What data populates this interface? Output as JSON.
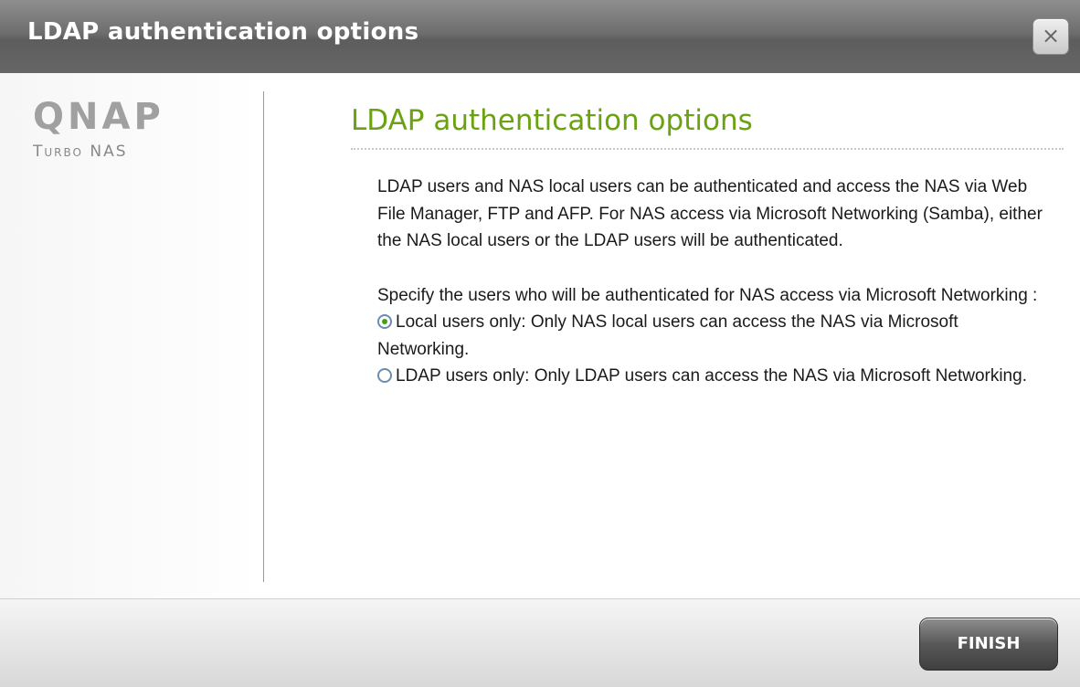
{
  "window": {
    "title": "LDAP authentication options",
    "close_icon": "close-icon",
    "close_glyph": "×"
  },
  "sidebar": {
    "logo_brand": "QNAP",
    "logo_sub": "Turbo NAS"
  },
  "main": {
    "heading": "LDAP authentication options",
    "intro": "LDAP users and NAS local users can be authenticated and access the NAS via Web File Manager, FTP and AFP. For NAS access via Microsoft Networking (Samba), either the NAS local users or the LDAP users will be authenticated.",
    "specify": "Specify the users who will be authenticated for NAS access via Microsoft Networking :",
    "options": [
      {
        "label": "Local users only: Only NAS local users can access the NAS via Microsoft Networking.",
        "selected": true
      },
      {
        "label": "LDAP users only: Only LDAP users can access the NAS via Microsoft Networking.",
        "selected": false
      }
    ]
  },
  "footer": {
    "finish_label": "FINISH"
  },
  "colors": {
    "heading": "#6aa212",
    "radio_selected": "#3ea40e",
    "titlebar": "#6e6e6e"
  }
}
